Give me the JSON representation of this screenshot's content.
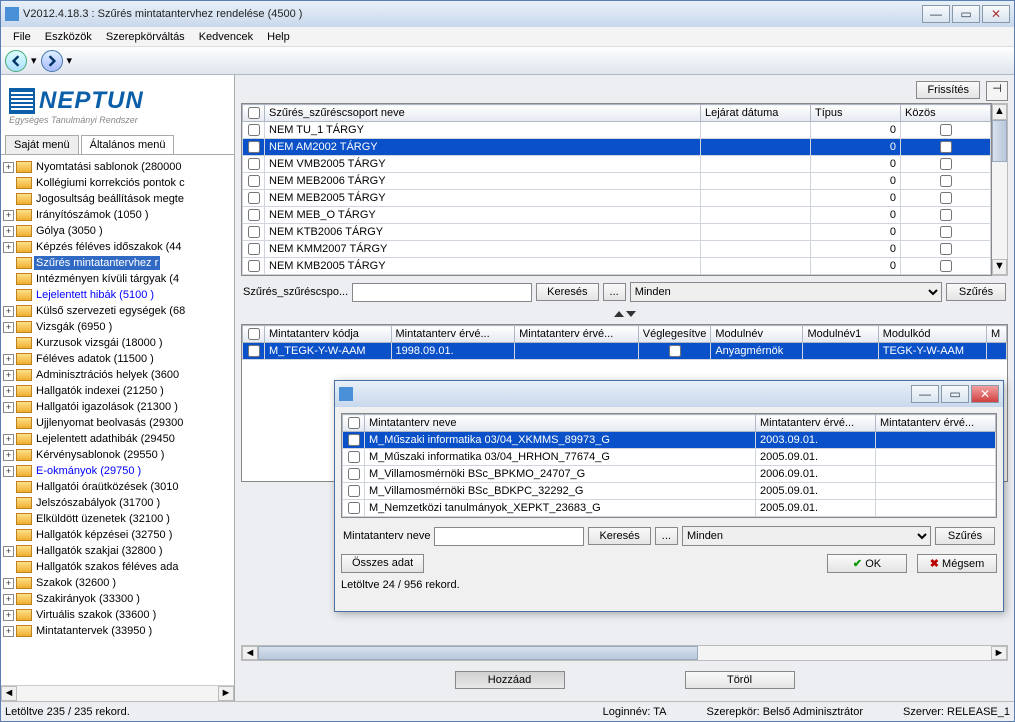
{
  "title": "V2012.4.18.3 : Szűrés mintatantervhez rendelése (4500  )",
  "menubar": [
    "File",
    "Eszközök",
    "Szerepkörváltás",
    "Kedvencek",
    "Help"
  ],
  "logo": {
    "name": "NEPTUN",
    "sub": "Egységes Tanulmányi Rendszer"
  },
  "sidetabs": {
    "t0": "Saját menü",
    "t1": "Általános menü"
  },
  "tree": [
    {
      "exp": "+",
      "lbl": "Nyomtatási sablonok (280000"
    },
    {
      "exp": "",
      "lbl": "Kollégiumi korrekciós pontok c"
    },
    {
      "exp": "",
      "lbl": "Jogosultság beállítások megte"
    },
    {
      "exp": "+",
      "lbl": "Irányítószámok (1050  )"
    },
    {
      "exp": "+",
      "lbl": "Gólya (3050  )"
    },
    {
      "exp": "+",
      "lbl": "Képzés féléves időszakok (44"
    },
    {
      "exp": "",
      "lbl": "Szűrés mintatantervhez r",
      "sel": true
    },
    {
      "exp": "",
      "lbl": "Intézményen kívüli tárgyak (4"
    },
    {
      "exp": "",
      "lbl": "Lejelentett hibák (5100  )",
      "blue": true
    },
    {
      "exp": "+",
      "lbl": "Külső szervezeti egységek (68"
    },
    {
      "exp": "+",
      "lbl": "Vizsgák (6950  )"
    },
    {
      "exp": "",
      "lbl": "Kurzusok vizsgái (18000  )"
    },
    {
      "exp": "+",
      "lbl": "Féléves adatok (11500  )"
    },
    {
      "exp": "+",
      "lbl": "Adminisztrációs helyek (3600"
    },
    {
      "exp": "+",
      "lbl": "Hallgatók indexei (21250  )"
    },
    {
      "exp": "+",
      "lbl": "Hallgatói igazolások (21300  )"
    },
    {
      "exp": "",
      "lbl": "Ujjlenyomat beolvasás (29300"
    },
    {
      "exp": "+",
      "lbl": "Lejelentett adathibák (29450"
    },
    {
      "exp": "+",
      "lbl": "Kérvénysablonok (29550  )"
    },
    {
      "exp": "+",
      "lbl": "E-okmányok (29750  )",
      "blue": true
    },
    {
      "exp": "",
      "lbl": "Hallgatói óraütközések (3010"
    },
    {
      "exp": "",
      "lbl": "Jelszószabályok (31700  )"
    },
    {
      "exp": "",
      "lbl": "Elküldött üzenetek (32100  )"
    },
    {
      "exp": "",
      "lbl": "Hallgatók képzései (32750  )"
    },
    {
      "exp": "+",
      "lbl": "Hallgatók szakjai (32800  )"
    },
    {
      "exp": "",
      "lbl": "Hallgatók szakos féléves ada"
    },
    {
      "exp": "+",
      "lbl": "Szakok (32600  )"
    },
    {
      "exp": "+",
      "lbl": "Szakirányok (33300  )"
    },
    {
      "exp": "+",
      "lbl": "Virtuális szakok (33600  )"
    },
    {
      "exp": "+",
      "lbl": "Mintatantervek (33950  )"
    }
  ],
  "topbtn": {
    "refresh": "Frissítés"
  },
  "grid1": {
    "headers": {
      "c0": "Szűrés_szűréscsoport neve",
      "c1": "Lejárat dátuma",
      "c2": "Típus",
      "c3": "Közös"
    },
    "rows": [
      {
        "n": "NEM TU_1 TÁRGY",
        "d": "",
        "t": "0"
      },
      {
        "n": "NEM AM2002 TÁRGY",
        "d": "",
        "t": "0",
        "sel": true
      },
      {
        "n": "NEM VMB2005 TÁRGY",
        "d": "",
        "t": "0"
      },
      {
        "n": "NEM MEB2006 TÁRGY",
        "d": "",
        "t": "0"
      },
      {
        "n": "NEM MEB2005 TÁRGY",
        "d": "",
        "t": "0"
      },
      {
        "n": "NEM MEB_O TÁRGY",
        "d": "",
        "t": "0"
      },
      {
        "n": "NEM KTB2006 TÁRGY",
        "d": "",
        "t": "0"
      },
      {
        "n": "NEM KMM2007 TÁRGY",
        "d": "",
        "t": "0"
      },
      {
        "n": "NEM KMB2005 TÁRGY",
        "d": "",
        "t": "0"
      }
    ]
  },
  "search1": {
    "label": "Szűrés_szűréscspo...",
    "btn": "Keresés",
    "filter": "Szűrés",
    "opt": "Minden"
  },
  "grid2": {
    "headers": {
      "c0": "Mintatanterv kódja",
      "c1": "Mintatanterv érvé...",
      "c2": "Mintatanterv érvé...",
      "c3": "Véglegesítve",
      "c4": "Modulnév",
      "c5": "Modulnév1",
      "c6": "Modulkód",
      "c7": "M"
    },
    "row": {
      "c0": "M_TEGK-Y-W-AAM",
      "c1": "1998.09.01.",
      "c4": "Anyagmérnök",
      "c6": "TEGK-Y-W-AAM"
    }
  },
  "actions": {
    "add": "Hozzáad",
    "del": "Töröl"
  },
  "status": {
    "rec": "Letöltve 235 / 235 rekord.",
    "login": "Loginnév: TA",
    "role": "Szerepkör: Belső Adminisztrátor",
    "server": "Szerver: RELEASE_1"
  },
  "dialog": {
    "headers": {
      "c0": "Mintatanterv neve",
      "c1": "Mintatanterv érvé...",
      "c2": "Mintatanterv érvé..."
    },
    "rows": [
      {
        "n": "M_Műszaki informatika 03/04_XKMMS_89973_G",
        "d": "2003.09.01.",
        "sel": true
      },
      {
        "n": "M_Műszaki informatika 03/04_HRHON_77674_G",
        "d": "2005.09.01."
      },
      {
        "n": "M_Villamosmérnöki BSc_BPKMO_24707_G",
        "d": "2006.09.01."
      },
      {
        "n": "M_Villamosmérnöki BSc_BDKPC_32292_G",
        "d": "2005.09.01."
      },
      {
        "n": "M_Nemzetközi tanulmányok_XEPKT_23683_G",
        "d": "2005.09.01."
      }
    ],
    "search": {
      "label": "Mintatanterv neve",
      "btn": "Keresés",
      "opt": "Minden",
      "filter": "Szűrés"
    },
    "all": "Összes adat",
    "ok": "OK",
    "cancel": "Mégsem",
    "rec": "Letöltve 24 / 956 rekord."
  }
}
